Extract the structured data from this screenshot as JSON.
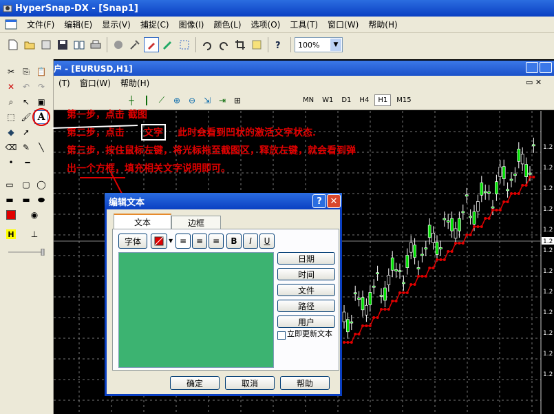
{
  "app": {
    "title": "HyperSnap-DX - [Snap1]"
  },
  "menu": [
    "文件(F)",
    "编辑(E)",
    "显示(V)",
    "捕捉(C)",
    "图像(I)",
    "颜色(L)",
    "选项(O)",
    "工具(T)",
    "窗口(W)",
    "帮助(H)"
  ],
  "toolbar": {
    "zoom": "100%"
  },
  "mt4": {
    "title_fragment": "户 - [EURUSD,H1]",
    "menu": [
      "(T)",
      "窗口(W)",
      "帮助(H)"
    ],
    "timeframes": [
      "MN",
      "W1",
      "D1",
      "H4",
      "H1",
      "M15"
    ],
    "price_label": "1.2"
  },
  "dialog": {
    "title": "编辑文本",
    "tab_text": "文本",
    "tab_border": "边框",
    "font_button": "字体",
    "bold": "B",
    "italic": "I",
    "underline": "U",
    "buttons": [
      "日期",
      "时间",
      "文件",
      "路径",
      "用户"
    ],
    "checkbox_label": "立即更新文本",
    "ok": "确定",
    "cancel": "取消",
    "help": "帮助"
  },
  "annotations": {
    "step1": "第一步，点击 截图",
    "step2_prefix": "第二步，点击",
    "step2_box": "文字",
    "step2_suffix": "此时会看到凹状的激活文字状态.",
    "step3": "第三步，按住鼠标左键，将光标拖至截图区，释放左键，就会看到弹",
    "step3b": "出一个方框，填充相关文字说明即可。"
  },
  "colors": {
    "annotation": "#e00000",
    "text_area": "#3cb371"
  }
}
